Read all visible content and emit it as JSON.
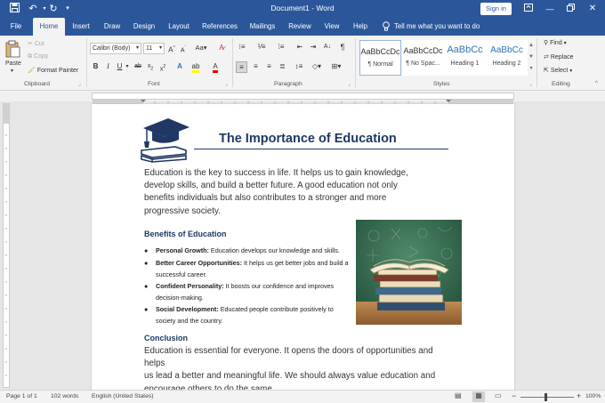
{
  "titlebar": {
    "title": "Document1 - Word",
    "sign_in": "Sign in"
  },
  "tabs": [
    "File",
    "Home",
    "Insert",
    "Draw",
    "Design",
    "Layout",
    "References",
    "Mailings",
    "Review",
    "View",
    "Help"
  ],
  "tell_me": "Tell me what you want to do",
  "ribbon": {
    "clipboard": {
      "paste": "Paste",
      "cut": "Cut",
      "copy": "Copy",
      "format_painter": "Format Painter",
      "label": "Clipboard"
    },
    "font": {
      "name": "Calibri (Body)",
      "size": "11",
      "label": "Font"
    },
    "paragraph": {
      "label": "Paragraph"
    },
    "styles": {
      "label": "Styles",
      "items": [
        {
          "sample": "AaBbCcDc",
          "name": "¶ Normal"
        },
        {
          "sample": "AaBbCcDc",
          "name": "¶ No Spac..."
        },
        {
          "sample": "AaBbCc",
          "name": "Heading 1"
        },
        {
          "sample": "AaBbCc",
          "name": "Heading 2"
        }
      ]
    },
    "editing": {
      "find": "Find",
      "replace": "Replace",
      "select": "Select",
      "label": "Editing"
    }
  },
  "document": {
    "title": "The Importance of Education",
    "intro": [
      "Education is the key to success in life. It helps us to gain knowledge,",
      "develop skills, and build a better future. A good education not only",
      "benefits individuals but also contributes to a stronger and more",
      "progressive society."
    ],
    "benefits_heading": "Benefits of Education",
    "bullets": [
      {
        "term": "Personal Growth:",
        "text": " Education develops our knowledge and skills."
      },
      {
        "term": "Better Career Opportunities:",
        "text": " It helps us get better jobs and build a successful career."
      },
      {
        "term": "Confident Personality:",
        "text": " It boosts our confidence and improves decision-making."
      },
      {
        "term": "Social Development:",
        "text": " Educated people contribute positively to society and the country."
      }
    ],
    "conclusion_heading": "Conclusion",
    "conclusion": [
      "Education is essential for everyone. It opens the doors of opportunities and helps",
      "us lead a better and meaningful life. We should always value education and",
      "encourage others to do the same."
    ]
  },
  "status": {
    "page": "Page 1 of 1",
    "words": "102 words",
    "language": "English (United States)",
    "zoom": "100%"
  },
  "colors": {
    "accent": "#2b579a",
    "heading": "#1f3864"
  }
}
